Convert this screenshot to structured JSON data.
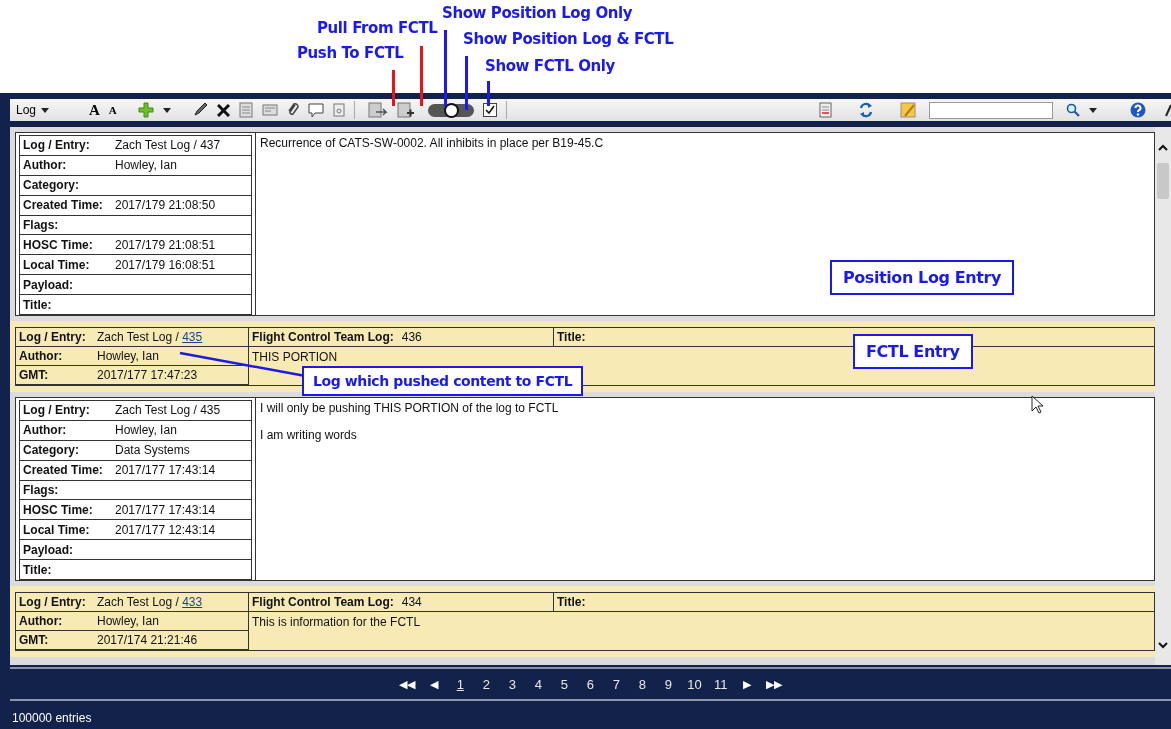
{
  "callouts": [
    {
      "label": "Show Position Log Only",
      "color": "#1a1aee"
    },
    {
      "label": "Pull From FCTL",
      "color": "#e8141b"
    },
    {
      "label": "Show Position Log & FCTL",
      "color": "#1a1aee"
    },
    {
      "label": "Push To FCTL",
      "color": "#e8141b"
    },
    {
      "label": "Show FCTL Only",
      "color": "#1a1aee"
    }
  ],
  "toolbar": {
    "log_menu": "Log",
    "font_larger": "A",
    "font_smaller": "A",
    "view_toggle": {
      "level": 0.5
    },
    "filter_checked": true
  },
  "entries": [
    {
      "kind": "position",
      "fields": [
        {
          "label": "Log / Entry:",
          "value": "Zach Test Log / 437"
        },
        {
          "label": "Author:",
          "value": "Howley, Ian"
        },
        {
          "label": "Category:"
        },
        {
          "label": "Created Time:",
          "value": "2017/179 21:08:50"
        },
        {
          "label": "Flags:"
        },
        {
          "label": "HOSC Time:",
          "value": "2017/179 21:08:51"
        },
        {
          "label": "Local Time:",
          "value": "2017/179 16:08:51"
        },
        {
          "label": "Payload:"
        },
        {
          "label": "Title:"
        }
      ],
      "text": [
        "Recurrence of CATS-SW-0002. All inhibits in place per B19-45.C"
      ],
      "callout": "Position Log Entry"
    },
    {
      "kind": "fctl",
      "fields": [
        {
          "label": "Log / Entry:",
          "value": "Zach Test Log / ",
          "link": "435"
        },
        {
          "label": "Author:",
          "value": "Howley, Ian"
        },
        {
          "label": "GMT:",
          "value": "2017/177 17:47:23"
        }
      ],
      "team_log_label": "Flight Control Team Log:",
      "team_log_number": "436",
      "title_label": "Title:",
      "text": "THIS PORTION",
      "callout": "FCTL Entry",
      "link_callout": "Log which pushed content to FCTL"
    },
    {
      "kind": "position",
      "fields": [
        {
          "label": "Log / Entry:",
          "value": "Zach Test Log / 435"
        },
        {
          "label": "Author:",
          "value": "Howley, Ian"
        },
        {
          "label": "Category:",
          "value": "Data Systems"
        },
        {
          "label": "Created Time:",
          "value": "2017/177 17:43:14"
        },
        {
          "label": "Flags:"
        },
        {
          "label": "HOSC Time:",
          "value": "2017/177 17:43:14"
        },
        {
          "label": "Local Time:",
          "value": "2017/177 12:43:14"
        },
        {
          "label": "Payload:"
        },
        {
          "label": "Title:"
        }
      ],
      "text": [
        "I will only be pushing THIS PORTION of the log to FCTL",
        "I am writing words"
      ]
    },
    {
      "kind": "fctl",
      "fields": [
        {
          "label": "Log / Entry:",
          "value": "Zach Test Log / ",
          "link": "433"
        },
        {
          "label": "Author:",
          "value": "Howley, Ian"
        },
        {
          "label": "GMT:",
          "value": "2017/174 21:21:46"
        }
      ],
      "team_log_label": "Flight Control Team Log:",
      "team_log_number": "434",
      "title_label": "Title:",
      "text": "This is information for the FCTL"
    }
  ],
  "pagination": {
    "first": "◀◀",
    "prev": "◀",
    "pages": [
      {
        "label": "1",
        "selected": true
      },
      {
        "label": "2",
        "selected": false
      },
      {
        "label": "3",
        "selected": false
      },
      {
        "label": "4",
        "selected": false
      },
      {
        "label": "5",
        "selected": false
      },
      {
        "label": "6",
        "selected": false
      },
      {
        "label": "7",
        "selected": false
      },
      {
        "label": "8",
        "selected": false
      },
      {
        "label": "9",
        "selected": false
      },
      {
        "label": "10",
        "selected": false
      },
      {
        "label": "11",
        "selected": false
      }
    ],
    "next": "▶",
    "last": "▶▶"
  },
  "status_bar": "100000 entries"
}
